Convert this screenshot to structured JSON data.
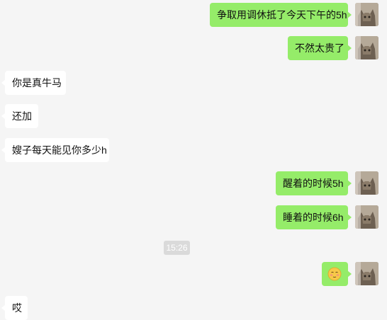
{
  "messages": [
    {
      "side": "out",
      "text": "争取用调休抵了今天下午的5h"
    },
    {
      "side": "out",
      "text": "不然太贵了"
    },
    {
      "side": "in",
      "text": "你是真牛马"
    },
    {
      "side": "in",
      "text": "还加"
    },
    {
      "side": "in",
      "text": "嫂子每天能见你多少h"
    },
    {
      "side": "out",
      "text": "醒着的时候5h"
    },
    {
      "side": "out",
      "text": "睡着的时候6h"
    },
    {
      "side": "time",
      "text": "15:26"
    },
    {
      "side": "out",
      "emoji": "blushing-face-emoji"
    },
    {
      "side": "in",
      "text": "哎"
    }
  ],
  "colors": {
    "background": "#f5f5f5",
    "outgoing_bubble": "#95ec69",
    "incoming_bubble": "#ffffff",
    "timestamp_bg": "#dadada"
  },
  "avatar_icon": "cat-avatar-icon"
}
